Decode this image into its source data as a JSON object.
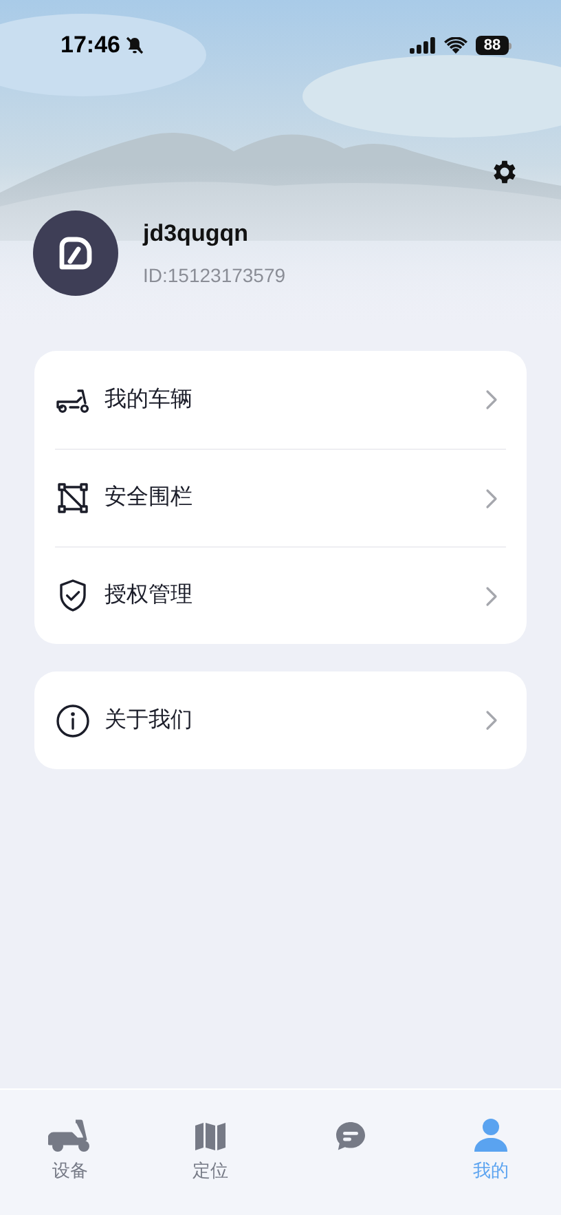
{
  "status_bar": {
    "time": "17:46",
    "battery": "88"
  },
  "profile": {
    "username": "jd3qugqn",
    "user_id": "ID:15123173579"
  },
  "menu_groups": [
    {
      "items": [
        {
          "label": "我的车辆"
        },
        {
          "label": "安全围栏"
        },
        {
          "label": "授权管理"
        }
      ]
    },
    {
      "items": [
        {
          "label": "关于我们"
        }
      ]
    }
  ],
  "tab_bar": [
    {
      "label": "设备",
      "selected": false
    },
    {
      "label": "定位",
      "selected": false
    },
    {
      "selected": false
    },
    {
      "label": "我的",
      "selected": true
    }
  ]
}
